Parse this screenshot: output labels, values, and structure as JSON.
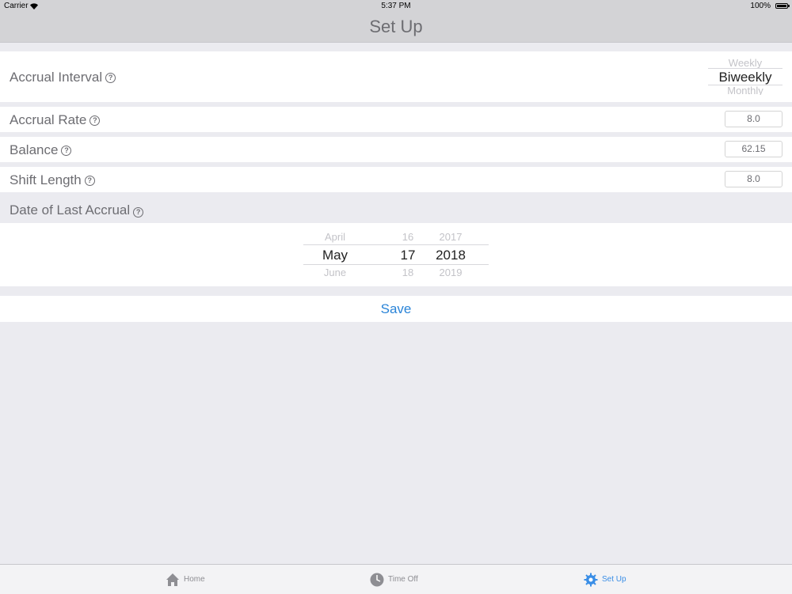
{
  "status_bar": {
    "carrier": "Carrier",
    "time": "5:37 PM",
    "battery": "100%"
  },
  "nav": {
    "title": "Set Up"
  },
  "accrual_interval": {
    "label": "Accrual Interval",
    "options_above": "Weekly",
    "selected": "Biweekly",
    "options_below": "Monthly"
  },
  "accrual_rate": {
    "label": "Accrual Rate",
    "value": "8.0"
  },
  "balance": {
    "label": "Balance",
    "value": "62.15"
  },
  "shift_length": {
    "label": "Shift Length",
    "value": "8.0"
  },
  "date_of_last_accrual": {
    "label": "Date of Last Accrual",
    "month": {
      "above": "April",
      "selected": "May",
      "below": "June"
    },
    "day": {
      "above": "16",
      "selected": "17",
      "below": "18"
    },
    "year": {
      "above": "2017",
      "selected": "2018",
      "below": "2019"
    }
  },
  "save_label": "Save",
  "help_glyph": "?",
  "tabs": [
    {
      "label": "Home",
      "icon": "house-icon"
    },
    {
      "label": "Time Off",
      "icon": "clock-icon"
    },
    {
      "label": "Set Up",
      "icon": "gear-icon"
    }
  ],
  "colors": {
    "accent": "#2a84d8",
    "tab_active": "#3a8ee6",
    "background": "#ebebf0"
  }
}
